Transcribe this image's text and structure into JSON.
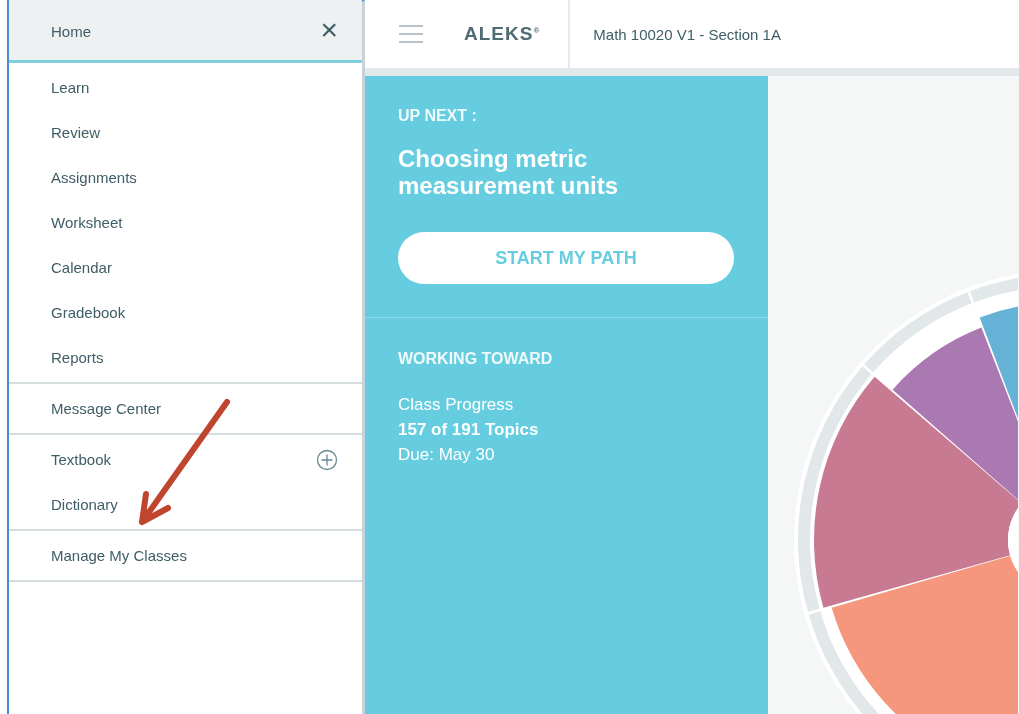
{
  "sidebar": {
    "header": {
      "title": "Home",
      "close_icon": "×"
    },
    "groups": [
      {
        "items": [
          {
            "label": "Learn",
            "kind": "link"
          },
          {
            "label": "Review",
            "kind": "link"
          },
          {
            "label": "Assignments",
            "kind": "link"
          },
          {
            "label": "Worksheet",
            "kind": "link"
          },
          {
            "label": "Calendar",
            "kind": "link"
          },
          {
            "label": "Gradebook",
            "kind": "link"
          },
          {
            "label": "Reports",
            "kind": "link"
          }
        ]
      },
      {
        "items": [
          {
            "label": "Message Center",
            "kind": "link"
          }
        ]
      },
      {
        "items": [
          {
            "label": "Textbook",
            "kind": "expandable"
          },
          {
            "label": "Dictionary",
            "kind": "link"
          }
        ]
      },
      {
        "items": [
          {
            "label": "Manage My Classes",
            "kind": "link"
          }
        ]
      }
    ]
  },
  "topbar": {
    "logo": "ALEKS$^{®}$",
    "course": "Math 10020 V1 - Section 1A"
  },
  "up_next": {
    "heading": "UP NEXT :",
    "topic": "Choosing metric measurement units",
    "button": "START MY PATH"
  },
  "working_toward": {
    "heading": "WORKING TOWARD",
    "label": "Class Progress",
    "topics": "157 of 191 Topics",
    "due": "Due: May 30"
  }
}
